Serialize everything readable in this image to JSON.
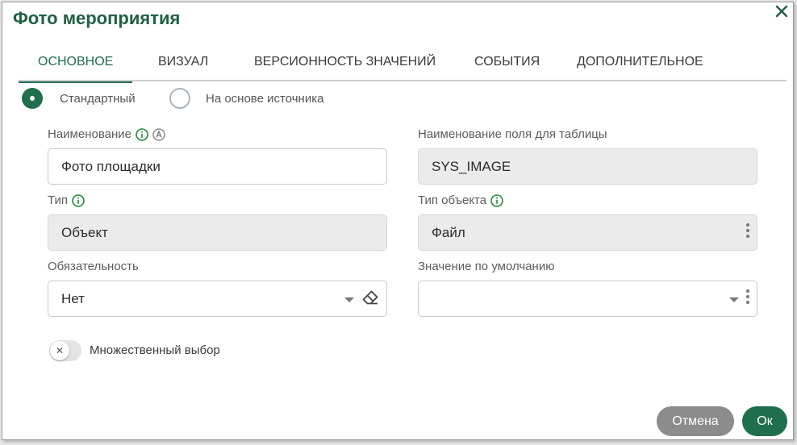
{
  "dialog": {
    "title": "Фото мероприятия"
  },
  "tabs": [
    {
      "label": "ОСНОВНОЕ",
      "active": true
    },
    {
      "label": "ВИЗУАЛ",
      "active": false
    },
    {
      "label": "ВЕРСИОННОСТЬ ЗНАЧЕНИЙ",
      "active": false
    },
    {
      "label": "СОБЫТИЯ",
      "active": false
    },
    {
      "label": "ДОПОЛНИТЕЛЬНОЕ",
      "active": false
    }
  ],
  "source_mode": {
    "options": [
      {
        "label": "Стандартный",
        "selected": true
      },
      {
        "label": "На основе источника",
        "selected": false
      }
    ]
  },
  "fields": {
    "name": {
      "label": "Наименование",
      "value": "Фото площадки"
    },
    "table_field_name": {
      "label": "Наименование поля для таблицы",
      "value": "SYS_IMAGE"
    },
    "type": {
      "label": "Тип",
      "value": "Объект"
    },
    "object_type": {
      "label": "Тип объекта",
      "value": "Файл"
    },
    "required": {
      "label": "Обязательность",
      "value": "Нет"
    },
    "default_value": {
      "label": "Значение по умолчанию",
      "value": ""
    }
  },
  "multiple_choice": {
    "label": "Множественный выбор",
    "enabled": false,
    "knob_symbol": "✕"
  },
  "buttons": {
    "cancel": "Отмена",
    "ok": "Ок"
  },
  "colors": {
    "accent": "#1f6e4c",
    "title": "#1f5f44",
    "cancel": "#8c8c8c"
  }
}
